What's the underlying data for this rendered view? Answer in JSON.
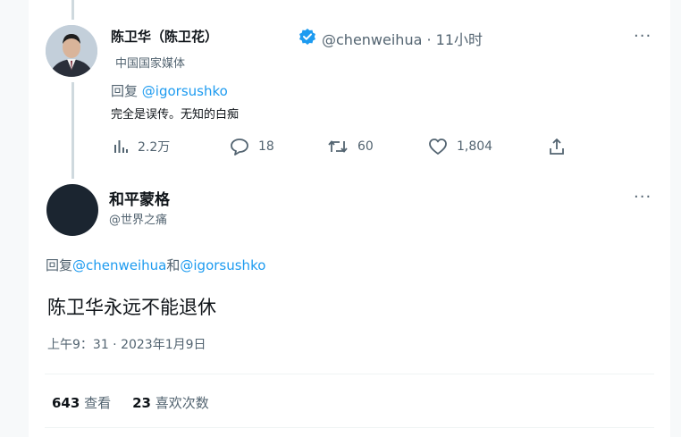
{
  "parent_tweet": {
    "display_name": "陈卫华（陈卫花）",
    "handle": "@chenweihua",
    "time_ago": "· 11小时",
    "account_label": "中国国家媒体",
    "reply_prefix": "回复",
    "reply_to": "@igorsushko",
    "text": "完全是误传。无知的白痴",
    "more_glyph": "···",
    "actions": {
      "views": "2.2万",
      "replies": "18",
      "retweets": "60",
      "likes": "1,804"
    },
    "icons": [
      "views-chart-icon",
      "reply-bubble-icon",
      "retweet-icon",
      "heart-icon",
      "share-icon",
      "verified-badge-icon"
    ]
  },
  "main_tweet": {
    "display_name": "和平蒙格",
    "handle": "@世界之痛",
    "more_glyph": "···",
    "reply_prefix": "回复",
    "reply_mention_1": "@chenweihua",
    "reply_conj": "和",
    "reply_mention_2": "@igorsushko",
    "text": "陈卫华永远不能退休",
    "timestamp": "上午9：31 · 2023年1月9日",
    "views_count": "643",
    "views_label": "查看",
    "likes_count": "23",
    "likes_label": "喜欢次数"
  },
  "colors": {
    "accent": "#1d9bf0",
    "secondary_text": "#536471",
    "primary_text": "#0f1419"
  }
}
